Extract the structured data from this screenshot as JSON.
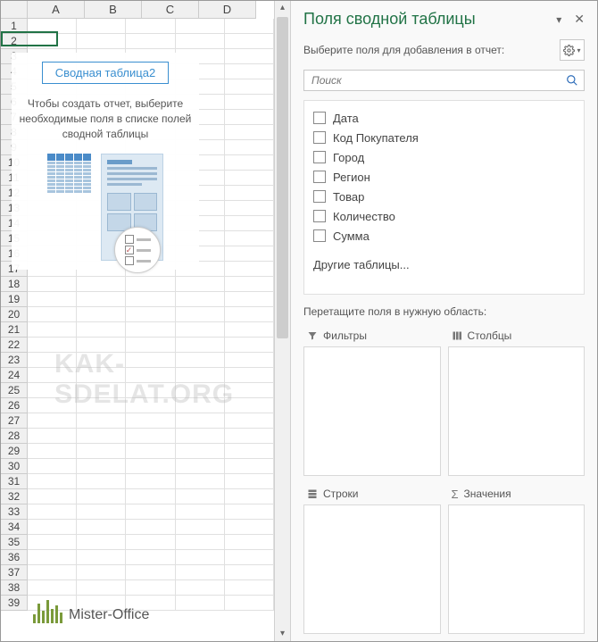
{
  "sheet": {
    "columns": [
      "A",
      "B",
      "C",
      "D"
    ],
    "row_count": 39,
    "selected_cell": "A3",
    "pivot_placeholder": {
      "title": "Сводная таблица2",
      "hint": "Чтобы создать отчет, выберите необходимые поля в списке полей сводной таблицы"
    }
  },
  "panel": {
    "title": "Поля сводной таблицы",
    "subtitle": "Выберите поля для добавления в отчет:",
    "search_placeholder": "Поиск",
    "fields": [
      {
        "label": "Дата",
        "checked": false
      },
      {
        "label": "Код Покупателя",
        "checked": false
      },
      {
        "label": "Город",
        "checked": false
      },
      {
        "label": "Регион",
        "checked": false
      },
      {
        "label": "Товар",
        "checked": false
      },
      {
        "label": "Количество",
        "checked": false
      },
      {
        "label": "Сумма",
        "checked": false
      }
    ],
    "other_tables": "Другие таблицы...",
    "areas_label": "Перетащите поля в нужную область:",
    "areas": {
      "filters": "Фильтры",
      "columns": "Столбцы",
      "rows": "Строки",
      "values": "Значения"
    }
  },
  "watermark": "KAK-SDELAT.ORG",
  "logo": "Mister-Office"
}
